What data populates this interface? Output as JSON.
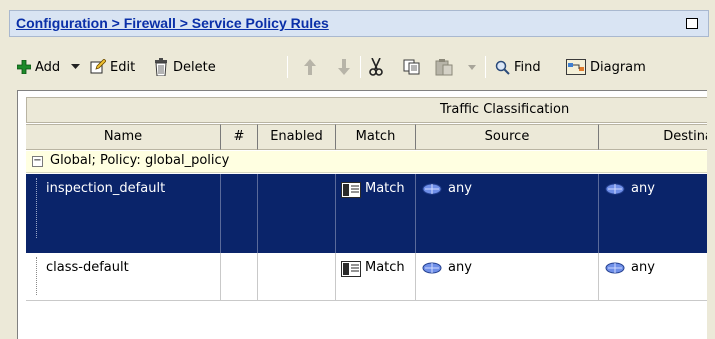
{
  "breadcrumb": "Configuration > Firewall > Service Policy Rules",
  "toolbar": {
    "add": "Add",
    "edit": "Edit",
    "delete": "Delete",
    "find": "Find",
    "diagram": "Diagram"
  },
  "table": {
    "group_header": "Traffic Classification",
    "columns": [
      "Name",
      "#",
      "Enabled",
      "Match",
      "Source",
      "Destinat"
    ],
    "group_row": "Global; Policy: global_policy",
    "rows": [
      {
        "name": "inspection_default",
        "number": "",
        "enabled": "",
        "match": "Match",
        "source": "any",
        "destination": "any",
        "selected": true
      },
      {
        "name": "class-default",
        "number": "",
        "enabled": "",
        "match": "Match",
        "source": "any",
        "destination": "any",
        "selected": false
      }
    ]
  },
  "colors": {
    "selection": "#0a246a",
    "title_link": "#0a2fa8",
    "group_row_bg": "#ffffe1",
    "add_icon": "#1d8a2a"
  }
}
